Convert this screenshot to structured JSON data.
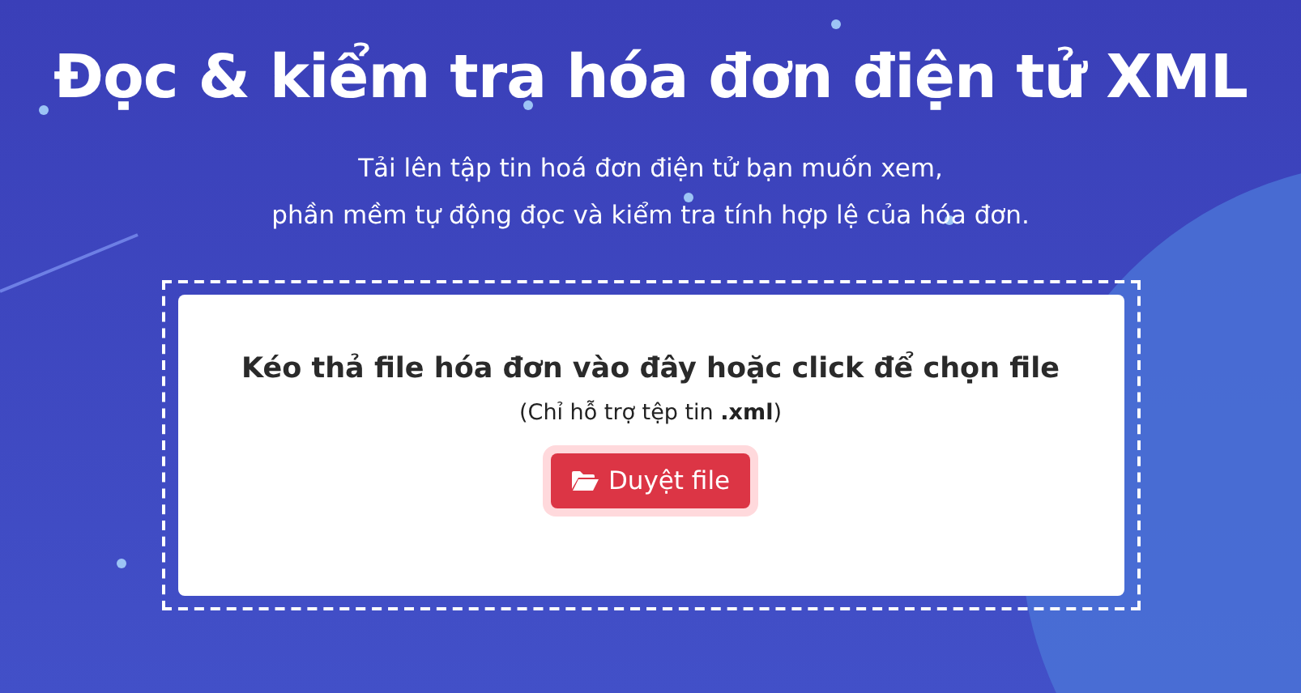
{
  "title": "Đọc & kiểm tra hóa đơn điện tử XML",
  "subtitle_lines": [
    "Tải lên tập tin hoá đơn điện tử bạn muốn xem,",
    "phần mềm tự động đọc và kiểm tra tính hợp lệ của hóa đơn."
  ],
  "dropzone": {
    "heading": "Kéo thả file hóa đơn vào đây hoặc click để chọn file",
    "note": "(Chỉ hỗ trợ tệp tin **.xml**)",
    "button": "Duyệt file"
  }
}
